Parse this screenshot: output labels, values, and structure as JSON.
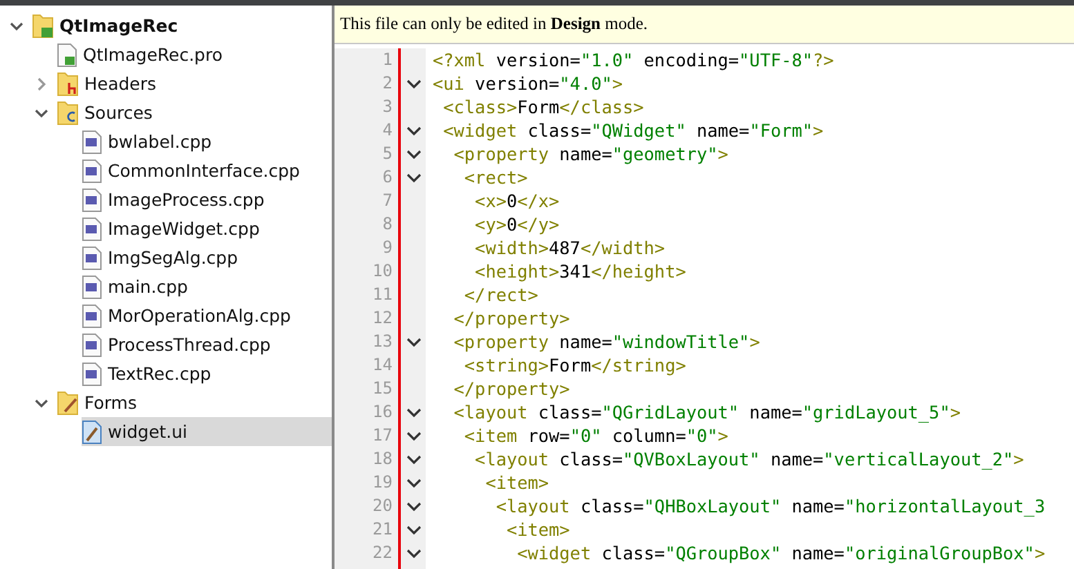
{
  "project_tree": {
    "items": [
      {
        "label": "QtImageRec",
        "kind": "project",
        "expanded": true,
        "selected": false,
        "children": [
          {
            "label": "QtImageRec.pro",
            "kind": "pro",
            "selected": false
          },
          {
            "label": "Headers",
            "kind": "headers",
            "expanded": false,
            "selected": false
          },
          {
            "label": "Sources",
            "kind": "sources",
            "expanded": true,
            "selected": false,
            "children": [
              {
                "label": "bwlabel.cpp",
                "kind": "cpp",
                "selected": false
              },
              {
                "label": "CommonInterface.cpp",
                "kind": "cpp",
                "selected": false
              },
              {
                "label": "ImageProcess.cpp",
                "kind": "cpp",
                "selected": false
              },
              {
                "label": "ImageWidget.cpp",
                "kind": "cpp",
                "selected": false
              },
              {
                "label": "ImgSegAlg.cpp",
                "kind": "cpp",
                "selected": false
              },
              {
                "label": "main.cpp",
                "kind": "cpp",
                "selected": false
              },
              {
                "label": "MorOperationAlg.cpp",
                "kind": "cpp",
                "selected": false
              },
              {
                "label": "ProcessThread.cpp",
                "kind": "cpp",
                "selected": false
              },
              {
                "label": "TextRec.cpp",
                "kind": "cpp",
                "selected": false
              }
            ]
          },
          {
            "label": "Forms",
            "kind": "forms",
            "expanded": true,
            "selected": false,
            "children": [
              {
                "label": "widget.ui",
                "kind": "ui",
                "selected": true
              }
            ]
          }
        ]
      }
    ]
  },
  "editor": {
    "notice": "This file can only be edited in **Design** mode.",
    "lines": [
      {
        "number": "1",
        "foldable": false,
        "tokens": [
          {
            "kind": "tag",
            "text": "<?xml"
          },
          {
            "kind": "attr",
            "text": " version="
          },
          {
            "kind": "value",
            "text": "\"1.0\""
          },
          {
            "kind": "attr",
            "text": " encoding="
          },
          {
            "kind": "value",
            "text": "\"UTF-8\""
          },
          {
            "kind": "tag",
            "text": "?>"
          }
        ]
      },
      {
        "number": "2",
        "foldable": true,
        "tokens": [
          {
            "kind": "tag",
            "text": "<ui"
          },
          {
            "kind": "attr",
            "text": " version="
          },
          {
            "kind": "value",
            "text": "\"4.0\""
          },
          {
            "kind": "tag",
            "text": ">"
          }
        ]
      },
      {
        "number": "3",
        "foldable": false,
        "tokens": [
          {
            "kind": "tag",
            "text": " <class>"
          },
          {
            "kind": "text",
            "text": "Form"
          },
          {
            "kind": "tag",
            "text": "</class>"
          }
        ]
      },
      {
        "number": "4",
        "foldable": true,
        "tokens": [
          {
            "kind": "tag",
            "text": " <widget"
          },
          {
            "kind": "attr",
            "text": " class="
          },
          {
            "kind": "value",
            "text": "\"QWidget\""
          },
          {
            "kind": "attr",
            "text": " name="
          },
          {
            "kind": "value",
            "text": "\"Form\""
          },
          {
            "kind": "tag",
            "text": ">"
          }
        ]
      },
      {
        "number": "5",
        "foldable": true,
        "tokens": [
          {
            "kind": "tag",
            "text": "  <property"
          },
          {
            "kind": "attr",
            "text": " name="
          },
          {
            "kind": "value",
            "text": "\"geometry\""
          },
          {
            "kind": "tag",
            "text": ">"
          }
        ]
      },
      {
        "number": "6",
        "foldable": true,
        "tokens": [
          {
            "kind": "tag",
            "text": "   <rect>"
          }
        ]
      },
      {
        "number": "7",
        "foldable": false,
        "tokens": [
          {
            "kind": "tag",
            "text": "    <x>"
          },
          {
            "kind": "text",
            "text": "0"
          },
          {
            "kind": "tag",
            "text": "</x>"
          }
        ]
      },
      {
        "number": "8",
        "foldable": false,
        "tokens": [
          {
            "kind": "tag",
            "text": "    <y>"
          },
          {
            "kind": "text",
            "text": "0"
          },
          {
            "kind": "tag",
            "text": "</y>"
          }
        ]
      },
      {
        "number": "9",
        "foldable": false,
        "tokens": [
          {
            "kind": "tag",
            "text": "    <width>"
          },
          {
            "kind": "text",
            "text": "487"
          },
          {
            "kind": "tag",
            "text": "</width>"
          }
        ]
      },
      {
        "number": "10",
        "foldable": false,
        "tokens": [
          {
            "kind": "tag",
            "text": "    <height>"
          },
          {
            "kind": "text",
            "text": "341"
          },
          {
            "kind": "tag",
            "text": "</height>"
          }
        ]
      },
      {
        "number": "11",
        "foldable": false,
        "tokens": [
          {
            "kind": "tag",
            "text": "   </rect>"
          }
        ]
      },
      {
        "number": "12",
        "foldable": false,
        "tokens": [
          {
            "kind": "tag",
            "text": "  </property>"
          }
        ]
      },
      {
        "number": "13",
        "foldable": true,
        "tokens": [
          {
            "kind": "tag",
            "text": "  <property"
          },
          {
            "kind": "attr",
            "text": " name="
          },
          {
            "kind": "value",
            "text": "\"windowTitle\""
          },
          {
            "kind": "tag",
            "text": ">"
          }
        ]
      },
      {
        "number": "14",
        "foldable": false,
        "tokens": [
          {
            "kind": "tag",
            "text": "   <string>"
          },
          {
            "kind": "text",
            "text": "Form"
          },
          {
            "kind": "tag",
            "text": "</string>"
          }
        ]
      },
      {
        "number": "15",
        "foldable": false,
        "tokens": [
          {
            "kind": "tag",
            "text": "  </property>"
          }
        ]
      },
      {
        "number": "16",
        "foldable": true,
        "tokens": [
          {
            "kind": "tag",
            "text": "  <layout"
          },
          {
            "kind": "attr",
            "text": " class="
          },
          {
            "kind": "value",
            "text": "\"QGridLayout\""
          },
          {
            "kind": "attr",
            "text": " name="
          },
          {
            "kind": "value",
            "text": "\"gridLayout_5\""
          },
          {
            "kind": "tag",
            "text": ">"
          }
        ]
      },
      {
        "number": "17",
        "foldable": true,
        "tokens": [
          {
            "kind": "tag",
            "text": "   <item"
          },
          {
            "kind": "attr",
            "text": " row="
          },
          {
            "kind": "value",
            "text": "\"0\""
          },
          {
            "kind": "attr",
            "text": " column="
          },
          {
            "kind": "value",
            "text": "\"0\""
          },
          {
            "kind": "tag",
            "text": ">"
          }
        ]
      },
      {
        "number": "18",
        "foldable": true,
        "tokens": [
          {
            "kind": "tag",
            "text": "    <layout"
          },
          {
            "kind": "attr",
            "text": " class="
          },
          {
            "kind": "value",
            "text": "\"QVBoxLayout\""
          },
          {
            "kind": "attr",
            "text": " name="
          },
          {
            "kind": "value",
            "text": "\"verticalLayout_2\""
          },
          {
            "kind": "tag",
            "text": ">"
          }
        ]
      },
      {
        "number": "19",
        "foldable": true,
        "tokens": [
          {
            "kind": "tag",
            "text": "     <item>"
          }
        ]
      },
      {
        "number": "20",
        "foldable": true,
        "tokens": [
          {
            "kind": "tag",
            "text": "      <layout"
          },
          {
            "kind": "attr",
            "text": " class="
          },
          {
            "kind": "value",
            "text": "\"QHBoxLayout\""
          },
          {
            "kind": "attr",
            "text": " name="
          },
          {
            "kind": "value",
            "text": "\"horizontalLayout_3"
          }
        ]
      },
      {
        "number": "21",
        "foldable": true,
        "tokens": [
          {
            "kind": "tag",
            "text": "       <item>"
          }
        ]
      },
      {
        "number": "22",
        "foldable": true,
        "tokens": [
          {
            "kind": "tag",
            "text": "        <widget"
          },
          {
            "kind": "attr",
            "text": " class="
          },
          {
            "kind": "value",
            "text": "\"QGroupBox\""
          },
          {
            "kind": "attr",
            "text": " name="
          },
          {
            "kind": "value",
            "text": "\"originalGroupBox\""
          },
          {
            "kind": "tag",
            "text": ">"
          }
        ]
      }
    ]
  }
}
